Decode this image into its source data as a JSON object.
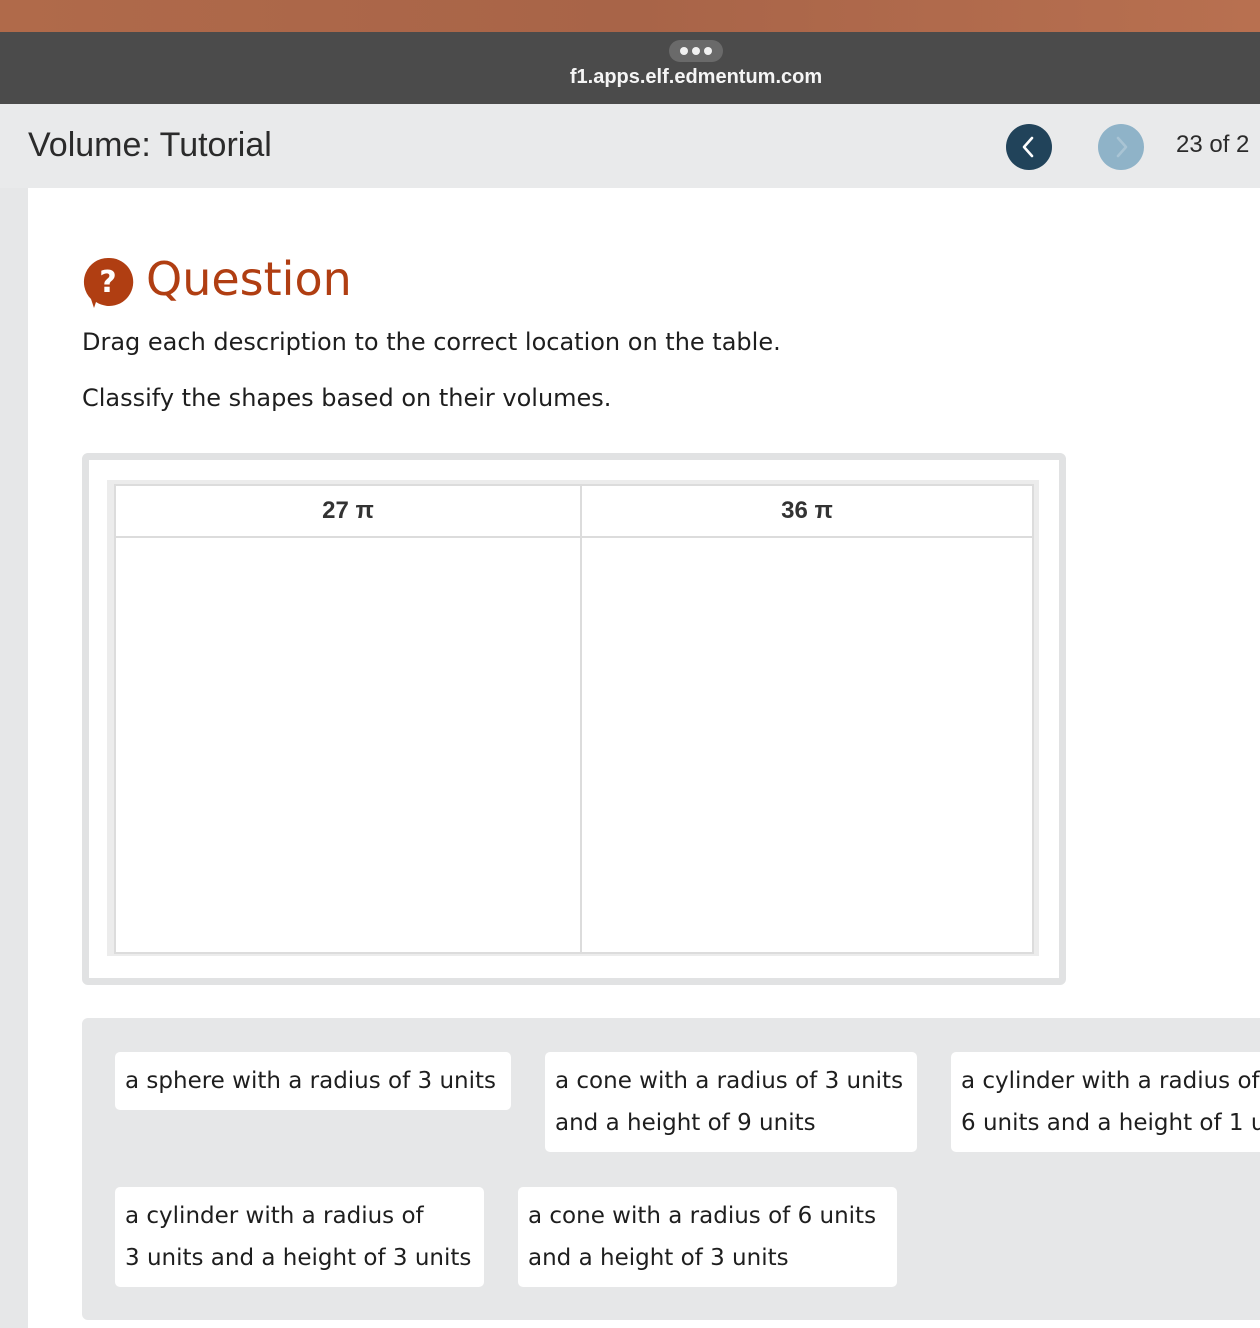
{
  "browser": {
    "url": "f1.apps.elf.edmentum.com"
  },
  "header": {
    "title": "Volume: Tutorial",
    "page_counter": "23  of  2"
  },
  "question": {
    "heading": "Question",
    "instruction_1": "Drag each description to the correct location on the table.",
    "instruction_2": "Classify the shapes based on their volumes."
  },
  "table": {
    "columns": [
      "27 π",
      "36 π"
    ]
  },
  "tiles": [
    {
      "line1": "a sphere with a radius of 3 units",
      "line2": ""
    },
    {
      "line1": "a cone with a radius of 3 units",
      "line2": "and a height of 9 units"
    },
    {
      "line1": "a cylinder with a radius of",
      "line2": "6 units and a height of 1 u"
    },
    {
      "line1": "a cylinder with a radius of",
      "line2": "3 units and a height of 3 units"
    },
    {
      "line1": "a cone with a radius of 6 units",
      "line2": "and a height of 3 units"
    }
  ],
  "colors": {
    "accent": "#b03e12",
    "nav_prev": "#21435a",
    "nav_next": "#8fb3c8",
    "panel": "#e6e7e8"
  },
  "icons": [
    "more-dots-icon",
    "chevron-left-icon",
    "chevron-right-icon",
    "question-icon"
  ]
}
